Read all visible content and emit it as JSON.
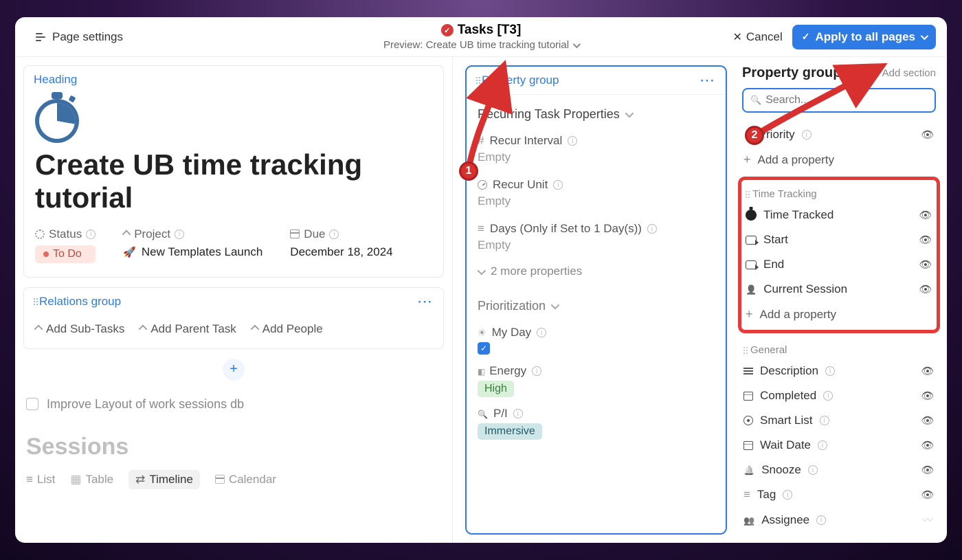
{
  "topbar": {
    "page_settings": "Page settings",
    "title": "Tasks [T3]",
    "preview_label": "Preview: Create UB time tracking tutorial",
    "cancel": "Cancel",
    "apply": "Apply to all pages"
  },
  "heading_card": {
    "header": "Heading",
    "title": "Create UB time tracking tutorial",
    "props": {
      "status_label": "Status",
      "status_value": "To Do",
      "project_label": "Project",
      "project_value": "New Templates Launch",
      "due_label": "Due",
      "due_value": "December 18, 2024"
    }
  },
  "relations_card": {
    "header": "Relations group",
    "add_sub": "Add Sub-Tasks",
    "add_parent": "Add Parent Task",
    "add_people": "Add People"
  },
  "left_content": {
    "todo": "Improve Layout of work sessions db",
    "sessions_label": "Sessions",
    "tabs": {
      "list": "List",
      "table": "Table",
      "timeline": "Timeline",
      "calendar": "Calendar"
    }
  },
  "mid": {
    "header": "Property group",
    "recurring": {
      "header": "Recurring Task Properties",
      "interval_label": "Recur Interval",
      "interval_value": "Empty",
      "unit_label": "Recur Unit",
      "unit_value": "Empty",
      "days_label": "Days (Only if Set to 1 Day(s))",
      "days_value": "Empty",
      "more": "2 more properties"
    },
    "prioritization": {
      "header": "Prioritization",
      "myday_label": "My Day",
      "myday_checked": true,
      "energy_label": "Energy",
      "energy_value": "High",
      "pi_label": "P/I",
      "pi_value": "Immersive"
    }
  },
  "right": {
    "title": "Property group",
    "add_section": "Add section",
    "search_placeholder": "Search...",
    "priority_label": "Priority",
    "add_property": "Add a property",
    "time_tracking": {
      "header": "Time Tracking",
      "tracked": "Time Tracked",
      "start": "Start",
      "end": "End",
      "session": "Current Session"
    },
    "general": {
      "header": "General",
      "description": "Description",
      "completed": "Completed",
      "smartlist": "Smart List",
      "waitdate": "Wait Date",
      "snooze": "Snooze",
      "tag": "Tag",
      "assignee": "Assignee"
    }
  },
  "callouts": {
    "one": "1",
    "two": "2"
  }
}
